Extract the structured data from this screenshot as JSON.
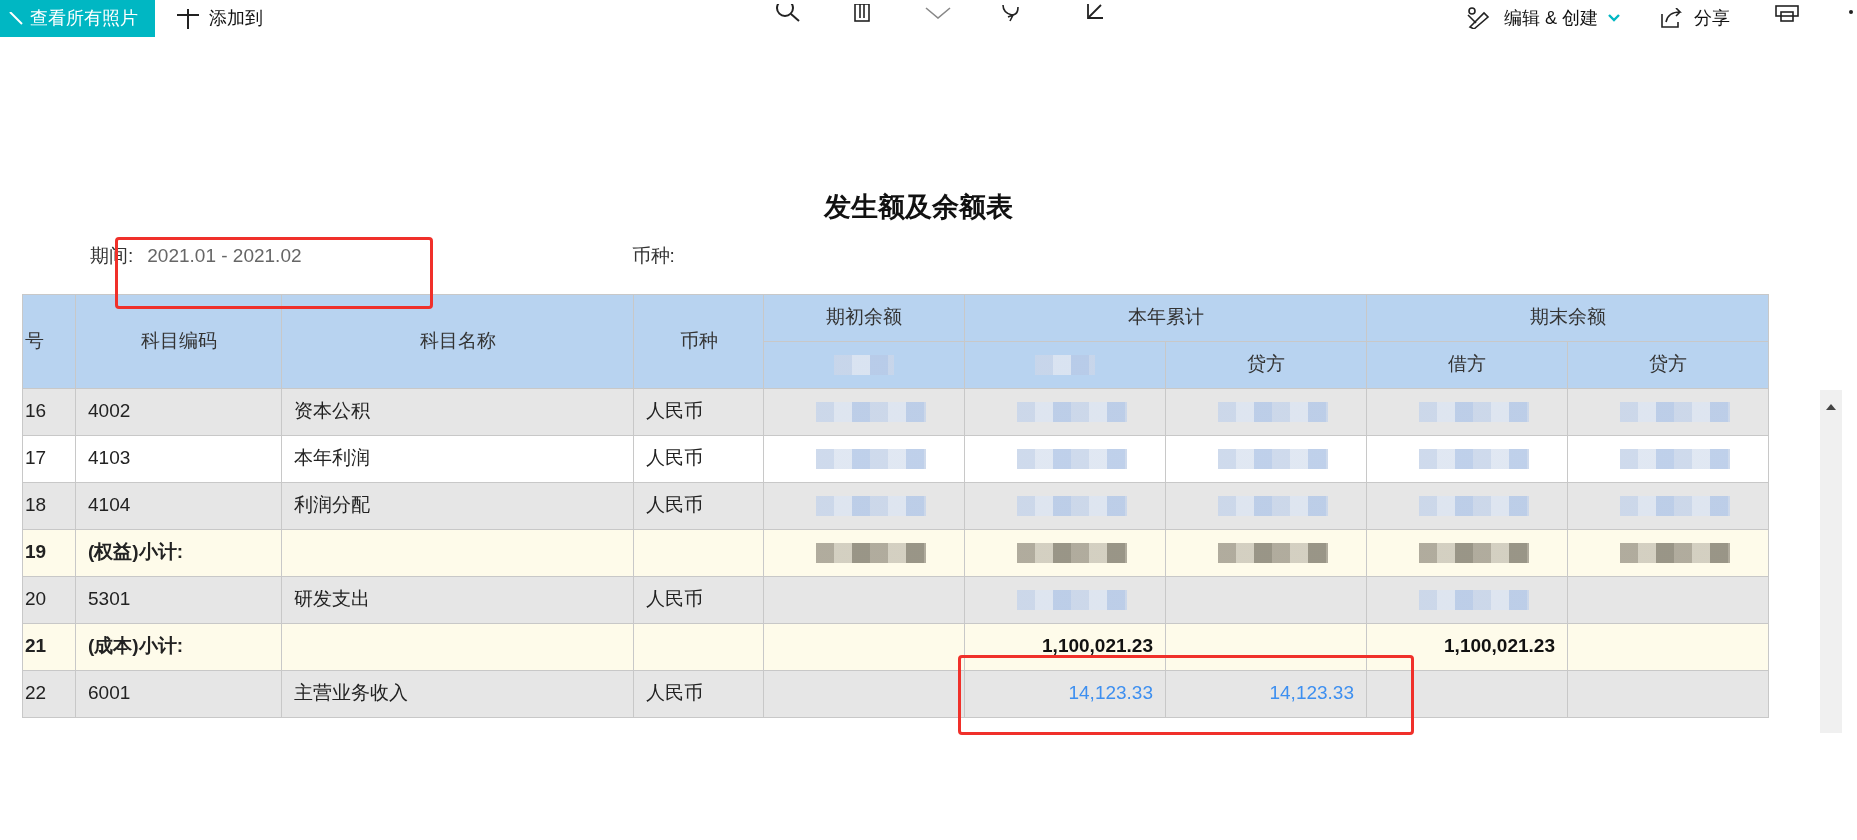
{
  "toolbar": {
    "view_all_button": "查看所有照片",
    "add_to_button": "添加到",
    "edit_create_button": "编辑 & 创建",
    "share_button": "分享"
  },
  "sheet": {
    "title": "发生额及余额表",
    "period_label": "期间:",
    "period_value": "2021.01 - 2021.02",
    "currency_label": "币种:",
    "header_top": [
      "号",
      "科目编码",
      "科目名称",
      "币种",
      "期初余额",
      "本年累计",
      "期末余额"
    ],
    "header_sub": [
      {
        "kind": "blurred"
      },
      {
        "kind": "blurred"
      },
      {
        "kind": "text",
        "text": "贷方"
      },
      {
        "kind": "text",
        "text": "借方"
      },
      {
        "kind": "text",
        "text": "贷方"
      }
    ],
    "rows": [
      {
        "kind": "normal",
        "shade": true,
        "no": "16",
        "code": "4002",
        "name": "资本公积",
        "currency": "人民币",
        "amounts": [
          {
            "kind": "blurred"
          },
          {
            "kind": "blurred"
          },
          {
            "kind": "blurred"
          },
          {
            "kind": "blurred"
          },
          {
            "kind": "blurred"
          }
        ]
      },
      {
        "kind": "normal",
        "shade": false,
        "no": "17",
        "code": "4103",
        "name": "本年利润",
        "currency": "人民币",
        "amounts": [
          {
            "kind": "blurred"
          },
          {
            "kind": "blurred"
          },
          {
            "kind": "blurred"
          },
          {
            "kind": "blurred"
          },
          {
            "kind": "blurred"
          }
        ]
      },
      {
        "kind": "normal",
        "shade": true,
        "no": "18",
        "code": "4104",
        "name": "利润分配",
        "currency": "人民币",
        "amounts": [
          {
            "kind": "blurred"
          },
          {
            "kind": "blurred"
          },
          {
            "kind": "blurred"
          },
          {
            "kind": "blurred"
          },
          {
            "kind": "blurred"
          }
        ]
      },
      {
        "kind": "subtotal",
        "no": "19",
        "code": "(权益)小计:",
        "amounts": [
          {
            "kind": "blurred"
          },
          {
            "kind": "blurred"
          },
          {
            "kind": "blurred"
          },
          {
            "kind": "blurred"
          },
          {
            "kind": "blurred"
          }
        ]
      },
      {
        "kind": "normal",
        "shade": true,
        "no": "20",
        "code": "5301",
        "name": "研发支出",
        "currency": "人民币",
        "amounts": [
          {
            "kind": "empty"
          },
          {
            "kind": "blurred"
          },
          {
            "kind": "empty"
          },
          {
            "kind": "blurred"
          },
          {
            "kind": "empty"
          }
        ]
      },
      {
        "kind": "subtotal",
        "no": "21",
        "code": "(成本)小计:",
        "amounts": [
          {
            "kind": "empty"
          },
          {
            "kind": "text",
            "text": "1,100,021.23"
          },
          {
            "kind": "empty"
          },
          {
            "kind": "text",
            "text": "1,100,021.23"
          },
          {
            "kind": "empty"
          }
        ]
      },
      {
        "kind": "normal",
        "shade": true,
        "no": "22",
        "code": "6001",
        "name": "主营业务收入",
        "currency": "人民币",
        "amounts": [
          {
            "kind": "empty"
          },
          {
            "kind": "text",
            "text": "14,123.33"
          },
          {
            "kind": "text",
            "text": "14,123.33"
          },
          {
            "kind": "empty"
          },
          {
            "kind": "empty"
          }
        ]
      }
    ]
  }
}
